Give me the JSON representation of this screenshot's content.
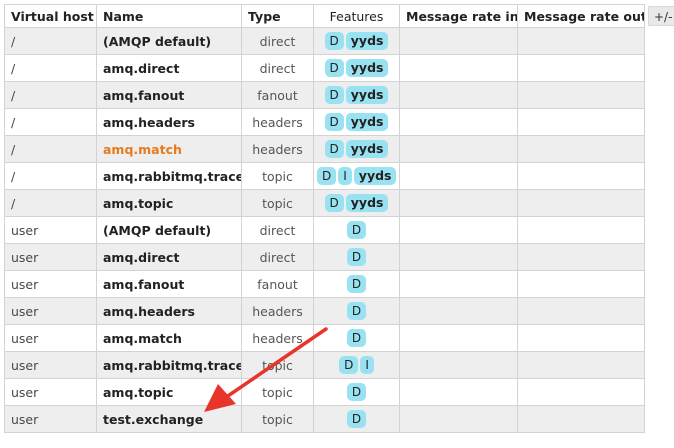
{
  "headers": {
    "vhost": "Virtual host",
    "name": "Name",
    "type": "Type",
    "features": "Features",
    "rate_in": "Message rate in",
    "rate_out": "Message rate out"
  },
  "column_toggle": "+/-",
  "rows": [
    {
      "vhost": "/",
      "name": "(AMQP default)",
      "type": "direct",
      "features": [
        "D",
        "yyds"
      ]
    },
    {
      "vhost": "/",
      "name": "amq.direct",
      "type": "direct",
      "features": [
        "D",
        "yyds"
      ]
    },
    {
      "vhost": "/",
      "name": "amq.fanout",
      "type": "fanout",
      "features": [
        "D",
        "yyds"
      ]
    },
    {
      "vhost": "/",
      "name": "amq.headers",
      "type": "headers",
      "features": [
        "D",
        "yyds"
      ]
    },
    {
      "vhost": "/",
      "name": "amq.match",
      "type": "headers",
      "features": [
        "D",
        "yyds"
      ],
      "highlight": "#e57a1f"
    },
    {
      "vhost": "/",
      "name": "amq.rabbitmq.trace",
      "type": "topic",
      "features": [
        "D",
        "I",
        "yyds"
      ]
    },
    {
      "vhost": "/",
      "name": "amq.topic",
      "type": "topic",
      "features": [
        "D",
        "yyds"
      ]
    },
    {
      "vhost": "user",
      "name": "(AMQP default)",
      "type": "direct",
      "features": [
        "D"
      ]
    },
    {
      "vhost": "user",
      "name": "amq.direct",
      "type": "direct",
      "features": [
        "D"
      ]
    },
    {
      "vhost": "user",
      "name": "amq.fanout",
      "type": "fanout",
      "features": [
        "D"
      ]
    },
    {
      "vhost": "user",
      "name": "amq.headers",
      "type": "headers",
      "features": [
        "D"
      ]
    },
    {
      "vhost": "user",
      "name": "amq.match",
      "type": "headers",
      "features": [
        "D"
      ]
    },
    {
      "vhost": "user",
      "name": "amq.rabbitmq.trace",
      "type": "topic",
      "features": [
        "D",
        "I"
      ]
    },
    {
      "vhost": "user",
      "name": "amq.topic",
      "type": "topic",
      "features": [
        "D"
      ]
    },
    {
      "vhost": "user",
      "name": "test.exchange",
      "type": "topic",
      "features": [
        "D"
      ]
    }
  ],
  "colors": {
    "badge": "#99e2f2",
    "row_alt": "#eeeeee",
    "highlight": "#e57a1f",
    "annotation_arrow": "#e8342a"
  }
}
